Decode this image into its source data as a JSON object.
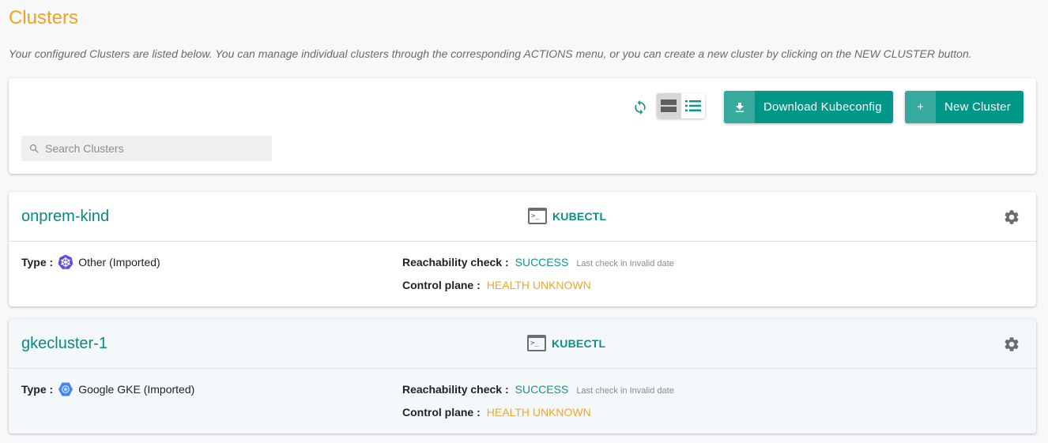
{
  "page": {
    "title": "Clusters",
    "description": "Your configured Clusters are listed below. You can manage individual clusters through the corresponding ACTIONS menu, or you can create a new cluster by clicking on the NEW CLUSTER button."
  },
  "toolbar": {
    "refresh_icon": "refresh-icon",
    "view_toggle": {
      "active": "card-view",
      "options": [
        "card-view",
        "list-view"
      ]
    },
    "download_button": {
      "icon": "download-icon",
      "label": "Download Kubeconfig"
    },
    "new_cluster_button": {
      "icon": "plus-icon",
      "label": "New Cluster"
    },
    "search": {
      "placeholder": "Search Clusters",
      "value": ""
    }
  },
  "clusters": [
    {
      "name": "onprem-kind",
      "kubectl_label": "KUBECTL",
      "type_label": "Type :",
      "type_icon": "kubernetes-icon",
      "type_value": "Other (Imported)",
      "reachability_label": "Reachability check :",
      "reachability_status": "SUCCESS",
      "reachability_note": "Last check in Invalid date",
      "control_plane_label": "Control plane :",
      "control_plane_status": "HEALTH UNKNOWN"
    },
    {
      "name": "gkecluster-1",
      "kubectl_label": "KUBECTL",
      "type_label": "Type :",
      "type_icon": "google-gke-icon",
      "type_value": "Google GKE (Imported)",
      "reachability_label": "Reachability check :",
      "reachability_status": "SUCCESS",
      "reachability_note": "Last check in Invalid date",
      "control_plane_label": "Control plane :",
      "control_plane_status": "HEALTH UNKNOWN"
    }
  ],
  "colors": {
    "title": "#f7a01c",
    "primary": "#009788",
    "primary_light": "#37aa9d",
    "link": "#088a80",
    "success": "#10958a",
    "warning": "#f5a623"
  }
}
